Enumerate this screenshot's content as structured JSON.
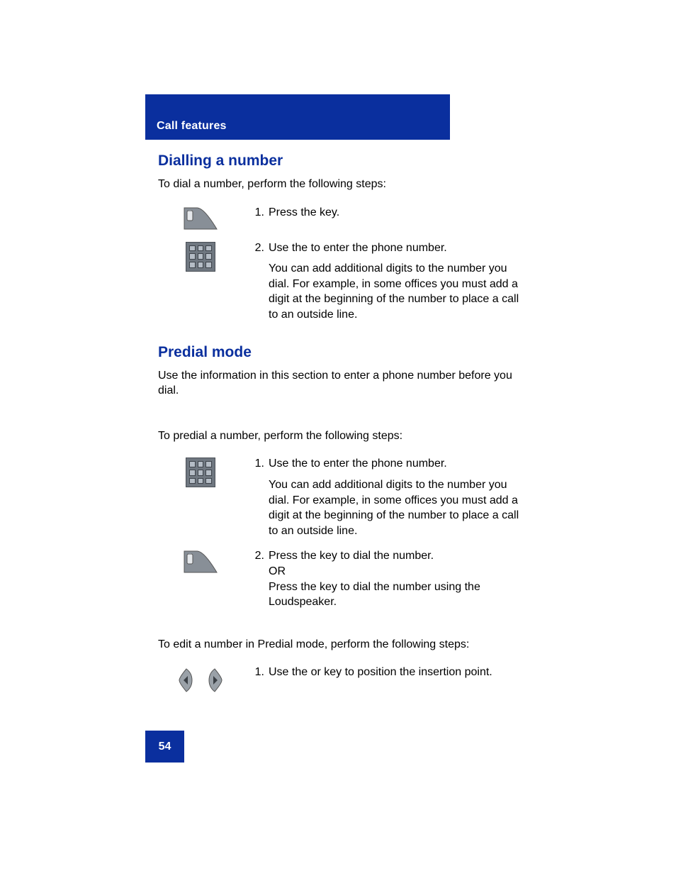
{
  "header": {
    "category": "Call features"
  },
  "sections": {
    "dialling": {
      "title": "Dialling a number",
      "intro": "To dial a number, perform the following steps:",
      "step1": {
        "num": "1.",
        "text": "Press the         key."
      },
      "step2": {
        "num": "2.",
        "text": "Use the              to enter the phone number.",
        "extra": "You can add additional digits to the number you dial. For example, in some offices you must add a digit at the beginning of the number to place a call to an outside line."
      }
    },
    "predial": {
      "title": "Predial mode",
      "intro": "Use the information in this section to enter a phone number before you dial.",
      "intro2": "To predial a number, perform the following steps:",
      "step1": {
        "num": "1.",
        "text": "Use the              to enter the phone number.",
        "extra": "You can add additional digits to the number you dial. For example, in some offices you must add a digit at the beginning of the number to place a call to an outside line."
      },
      "step2": {
        "num": "2.",
        "line1": "Press the         key to dial the number.",
        "line2": "OR",
        "line3": "Press the         key to dial the number using the Loudspeaker."
      },
      "edit_intro": "To edit a number in Predial mode, perform the following steps:",
      "edit_step1": {
        "num": "1.",
        "text": "Use the        or           key to position the insertion point."
      }
    }
  },
  "page_number": "54"
}
